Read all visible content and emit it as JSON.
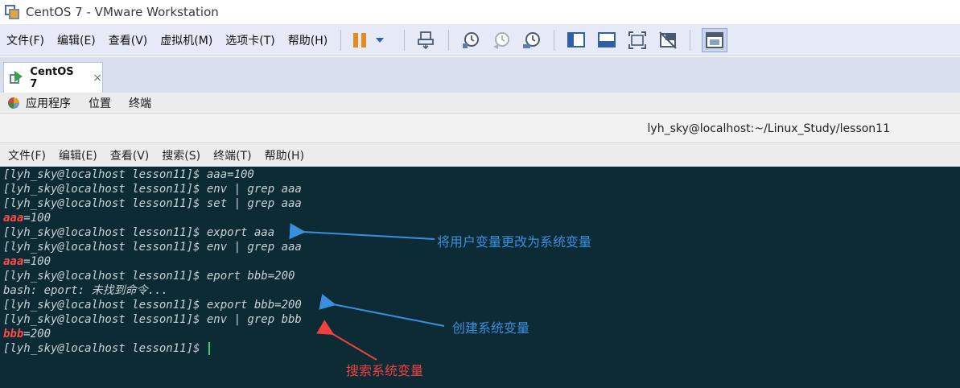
{
  "window": {
    "title": "CentOS 7 - VMware Workstation"
  },
  "menubar": {
    "items": [
      "文件(F)",
      "编辑(E)",
      "查看(V)",
      "虚拟机(M)",
      "选项卡(T)",
      "帮助(H)"
    ]
  },
  "toolbar": {
    "icons": [
      "pause-icon",
      "dropdown-arrow-icon",
      "send-ctrl-alt-del-icon",
      "snapshot-icon",
      "revert-snapshot-icon",
      "snapshot-manager-icon",
      "show-library-icon",
      "thumbnail-icon",
      "full-screen-icon",
      "unity-icon",
      "console-view-icon"
    ]
  },
  "tabs": [
    {
      "label": "CentOS 7",
      "close": "×"
    }
  ],
  "gnome": {
    "items": [
      "应用程序",
      "位置",
      "终端"
    ]
  },
  "terminal": {
    "title": "lyh_sky@localhost:~/Linux_Study/lesson11",
    "menu": [
      "文件(F)",
      "编辑(E)",
      "查看(V)",
      "搜索(S)",
      "终端(T)",
      "帮助(H)"
    ],
    "lines": [
      {
        "pre": "[lyh_sky@localhost lesson11]$ aaa=100",
        "hl": "",
        "post": ""
      },
      {
        "pre": "[lyh_sky@localhost lesson11]$ env | grep aaa",
        "hl": "",
        "post": ""
      },
      {
        "pre": "[lyh_sky@localhost lesson11]$ set | grep aaa",
        "hl": "",
        "post": ""
      },
      {
        "pre": "",
        "hl": "aaa",
        "post": "=100"
      },
      {
        "pre": "[lyh_sky@localhost lesson11]$ export aaa",
        "hl": "",
        "post": ""
      },
      {
        "pre": "[lyh_sky@localhost lesson11]$ env | grep aaa",
        "hl": "",
        "post": ""
      },
      {
        "pre": "",
        "hl": "aaa",
        "post": "=100"
      },
      {
        "pre": "[lyh_sky@localhost lesson11]$ eport bbb=200",
        "hl": "",
        "post": ""
      },
      {
        "pre": "bash: eport: 未找到命令...",
        "hl": "",
        "post": ""
      },
      {
        "pre": "[lyh_sky@localhost lesson11]$ export bbb=200",
        "hl": "",
        "post": ""
      },
      {
        "pre": "[lyh_sky@localhost lesson11]$ env | grep bbb",
        "hl": "",
        "post": ""
      },
      {
        "pre": "",
        "hl": "bbb",
        "post": "=200"
      },
      {
        "pre": "[lyh_sky@localhost lesson11]$ ",
        "hl": "",
        "post": ""
      }
    ]
  },
  "annotations": {
    "a1": "将用户变量更改为系统变量",
    "a2": "创建系统变量",
    "a3": "搜索系统变量"
  },
  "colors": {
    "terminal_bg": "#0c2b35",
    "terminal_text": "#c9d2d6",
    "highlight": "#ff4a4a",
    "annotation_blue": "#3b8fe0",
    "annotation_red": "#f04040"
  }
}
